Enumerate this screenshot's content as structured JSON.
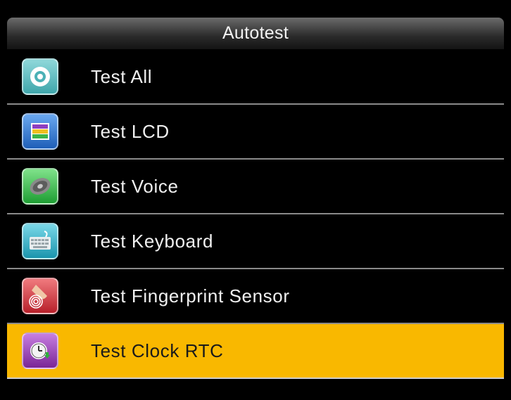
{
  "header": {
    "title": "Autotest"
  },
  "menu": {
    "items": [
      {
        "label": "Test All",
        "icon": "target-icon",
        "icon_color": "#5bbcc0",
        "selected": false
      },
      {
        "label": "Test LCD",
        "icon": "lcd-bars-icon",
        "icon_color": "#3b7fd6",
        "selected": false
      },
      {
        "label": "Test Voice",
        "icon": "speaker-icon",
        "icon_color": "#39c24a",
        "selected": false
      },
      {
        "label": "Test Keyboard",
        "icon": "keyboard-icon",
        "icon_color": "#29b6cf",
        "selected": false
      },
      {
        "label": "Test Fingerprint Sensor",
        "icon": "fingerprint-icon",
        "icon_color": "#d8343c",
        "selected": false
      },
      {
        "label": "Test Clock RTC",
        "icon": "clock-icon",
        "icon_color": "#9b3fb8",
        "selected": true
      }
    ]
  },
  "colors": {
    "background": "#000000",
    "selected_row": "#f9b800",
    "divider": "#8a8a8a"
  }
}
